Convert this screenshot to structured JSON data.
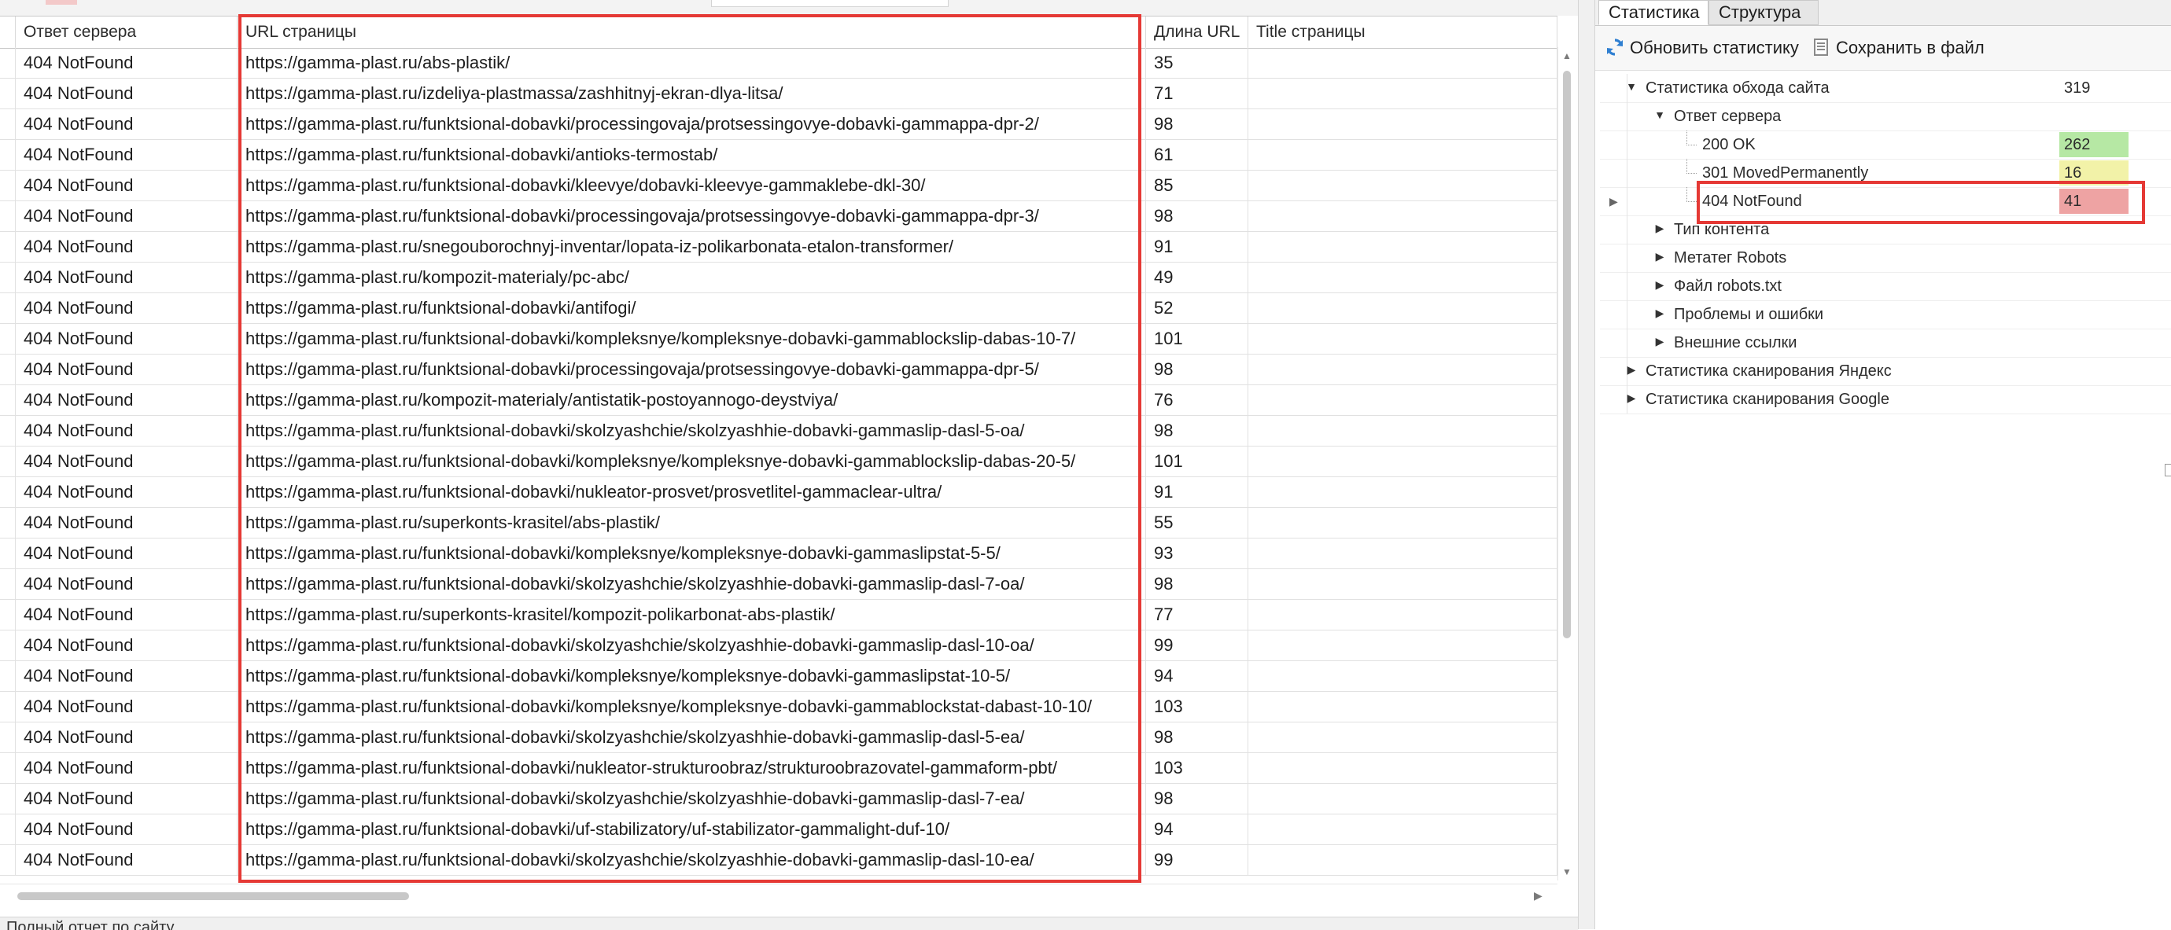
{
  "grid": {
    "columns": [
      "Ответ сервера",
      "URL страницы",
      "Длина URL",
      "Title страницы"
    ],
    "rows": [
      {
        "status": "404 NotFound",
        "url": "https://gamma-plast.ru/abs-plastik/",
        "length": "35"
      },
      {
        "status": "404 NotFound",
        "url": "https://gamma-plast.ru/izdeliya-plastmassa/zashhitnyj-ekran-dlya-litsa/",
        "length": "71"
      },
      {
        "status": "404 NotFound",
        "url": "https://gamma-plast.ru/funktsional-dobavki/processingovaja/protsessingovye-dobavki-gammappa-dpr-2/",
        "length": "98"
      },
      {
        "status": "404 NotFound",
        "url": "https://gamma-plast.ru/funktsional-dobavki/antioks-termostab/",
        "length": "61"
      },
      {
        "status": "404 NotFound",
        "url": "https://gamma-plast.ru/funktsional-dobavki/kleevye/dobavki-kleevye-gammaklebe-dkl-30/",
        "length": "85"
      },
      {
        "status": "404 NotFound",
        "url": "https://gamma-plast.ru/funktsional-dobavki/processingovaja/protsessingovye-dobavki-gammappa-dpr-3/",
        "length": "98"
      },
      {
        "status": "404 NotFound",
        "url": "https://gamma-plast.ru/snegouborochnyj-inventar/lopata-iz-polikarbonata-etalon-transformer/",
        "length": "91"
      },
      {
        "status": "404 NotFound",
        "url": "https://gamma-plast.ru/kompozit-materialy/pc-abc/",
        "length": "49"
      },
      {
        "status": "404 NotFound",
        "url": "https://gamma-plast.ru/funktsional-dobavki/antifogi/",
        "length": "52"
      },
      {
        "status": "404 NotFound",
        "url": "https://gamma-plast.ru/funktsional-dobavki/kompleksnye/kompleksnye-dobavki-gammablockslip-dabas-10-7/",
        "length": "101"
      },
      {
        "status": "404 NotFound",
        "url": "https://gamma-plast.ru/funktsional-dobavki/processingovaja/protsessingovye-dobavki-gammappa-dpr-5/",
        "length": "98"
      },
      {
        "status": "404 NotFound",
        "url": "https://gamma-plast.ru/kompozit-materialy/antistatik-postoyannogo-deystviya/",
        "length": "76"
      },
      {
        "status": "404 NotFound",
        "url": "https://gamma-plast.ru/funktsional-dobavki/skolzyashchie/skolzyashhie-dobavki-gammaslip-dasl-5-oa/",
        "length": "98"
      },
      {
        "status": "404 NotFound",
        "url": "https://gamma-plast.ru/funktsional-dobavki/kompleksnye/kompleksnye-dobavki-gammablockslip-dabas-20-5/",
        "length": "101"
      },
      {
        "status": "404 NotFound",
        "url": "https://gamma-plast.ru/funktsional-dobavki/nukleator-prosvet/prosvetlitel-gammaclear-ultra/",
        "length": "91"
      },
      {
        "status": "404 NotFound",
        "url": "https://gamma-plast.ru/superkonts-krasitel/abs-plastik/",
        "length": "55"
      },
      {
        "status": "404 NotFound",
        "url": "https://gamma-plast.ru/funktsional-dobavki/kompleksnye/kompleksnye-dobavki-gammaslipstat-5-5/",
        "length": "93"
      },
      {
        "status": "404 NotFound",
        "url": "https://gamma-plast.ru/funktsional-dobavki/skolzyashchie/skolzyashhie-dobavki-gammaslip-dasl-7-oa/",
        "length": "98"
      },
      {
        "status": "404 NotFound",
        "url": "https://gamma-plast.ru/superkonts-krasitel/kompozit-polikarbonat-abs-plastik/",
        "length": "77"
      },
      {
        "status": "404 NotFound",
        "url": "https://gamma-plast.ru/funktsional-dobavki/skolzyashchie/skolzyashhie-dobavki-gammaslip-dasl-10-oa/",
        "length": "99"
      },
      {
        "status": "404 NotFound",
        "url": "https://gamma-plast.ru/funktsional-dobavki/kompleksnye/kompleksnye-dobavki-gammaslipstat-10-5/",
        "length": "94"
      },
      {
        "status": "404 NotFound",
        "url": "https://gamma-plast.ru/funktsional-dobavki/kompleksnye/kompleksnye-dobavki-gammablockstat-dabast-10-10/",
        "length": "103"
      },
      {
        "status": "404 NotFound",
        "url": "https://gamma-plast.ru/funktsional-dobavki/skolzyashchie/skolzyashhie-dobavki-gammaslip-dasl-5-ea/",
        "length": "98"
      },
      {
        "status": "404 NotFound",
        "url": "https://gamma-plast.ru/funktsional-dobavki/nukleator-strukturoobraz/strukturoobrazovatel-gammaform-pbt/",
        "length": "103"
      },
      {
        "status": "404 NotFound",
        "url": "https://gamma-plast.ru/funktsional-dobavki/skolzyashchie/skolzyashhie-dobavki-gammaslip-dasl-7-ea/",
        "length": "98"
      },
      {
        "status": "404 NotFound",
        "url": "https://gamma-plast.ru/funktsional-dobavki/uf-stabilizatory/uf-stabilizator-gammalight-duf-10/",
        "length": "94"
      },
      {
        "status": "404 NotFound",
        "url": "https://gamma-plast.ru/funktsional-dobavki/skolzyashchie/skolzyashhie-dobavki-gammaslip-dasl-10-ea/",
        "length": "99"
      }
    ]
  },
  "status_bar": {
    "text": "Полный отчет по сайту"
  },
  "right_panel": {
    "tabs": [
      "Статистика",
      "Структура"
    ],
    "toolbar": {
      "refresh_label": "Обновить статистику",
      "save_label": "Сохранить в файл"
    },
    "tree": [
      {
        "label": "Статистика обхода сайта",
        "value": "319",
        "level": 0,
        "expanded": true,
        "color": "plain"
      },
      {
        "label": "Ответ сервера",
        "value": "",
        "level": 1,
        "expanded": true,
        "color": "plain"
      },
      {
        "label": "200 OK",
        "value": "262",
        "level": 2,
        "expanded": null,
        "color": "green"
      },
      {
        "label": "301 MovedPermanently",
        "value": "16",
        "level": 2,
        "expanded": null,
        "color": "yellow"
      },
      {
        "label": "404 NotFound",
        "value": "41",
        "level": 2,
        "expanded": null,
        "color": "red",
        "selected": true
      },
      {
        "label": "Тип контента",
        "value": "",
        "level": 1,
        "expanded": false,
        "color": "plain"
      },
      {
        "label": "Метатег Robots",
        "value": "",
        "level": 1,
        "expanded": false,
        "color": "plain"
      },
      {
        "label": "Файл robots.txt",
        "value": "",
        "level": 1,
        "expanded": false,
        "color": "plain"
      },
      {
        "label": "Проблемы и ошибки",
        "value": "",
        "level": 1,
        "expanded": false,
        "color": "plain"
      },
      {
        "label": "Внешние ссылки",
        "value": "",
        "level": 1,
        "expanded": false,
        "color": "plain"
      },
      {
        "label": "Статистика сканирования Яндекс",
        "value": "",
        "level": 0,
        "expanded": false,
        "color": "plain"
      },
      {
        "label": "Статистика сканирования Google",
        "value": "",
        "level": 0,
        "expanded": false,
        "color": "plain"
      }
    ]
  },
  "colors": {
    "highlight": "#e53935",
    "ok": "#b6e8a4",
    "redirect": "#f2f2a8",
    "notfound": "#eea3a3"
  },
  "icons": {
    "refresh": "refresh-icon",
    "save": "save-file-icon"
  }
}
